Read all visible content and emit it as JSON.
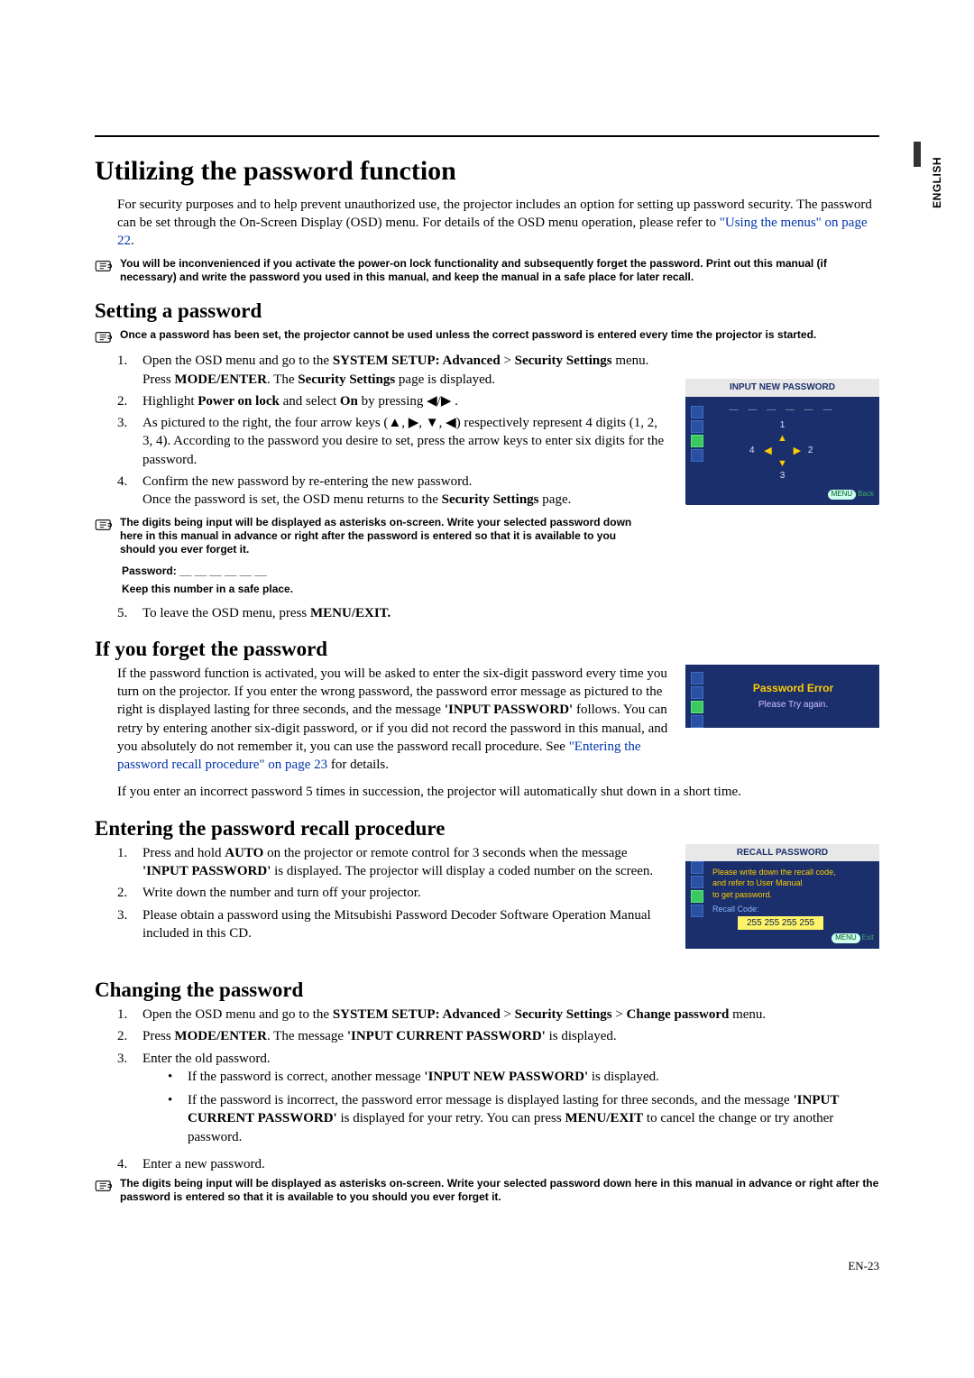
{
  "lang_tab": "ENGLISH",
  "h1": "Utilizing the password function",
  "intro_pre": "For security purposes and to help prevent unauthorized use, the projector includes an option for setting up password security. The password can be set through the On-Screen Display (OSD) menu. For details of the OSD menu operation, please refer to ",
  "intro_link": "\"Using the menus\" on page 22",
  "intro_post": ".",
  "note1": "You will be inconvenienced if you activate the power-on lock functionality and subsequently forget the password. Print out this manual (if necessary) and write the password you used in this manual, and keep the manual in a safe place for later recall.",
  "h2a": "Setting a password",
  "note2": "Once a password has been set, the projector cannot be used unless the correct password is entered every time the projector is started.",
  "stepsA": {
    "s1_a": "Open the OSD menu and go to the ",
    "s1_b": "SYSTEM SETUP: Advanced",
    "s1_c": " > ",
    "s1_d": "Security Settings",
    "s1_e": " menu. Press ",
    "s1_f": "MODE/ENTER",
    "s1_g": ". The ",
    "s1_h": "Security Settings",
    "s1_i": " page is displayed.",
    "s2_a": "Highlight ",
    "s2_b": "Power on lock",
    "s2_c": " and select ",
    "s2_d": "On",
    "s2_e": " by pressing ◀/▶ .",
    "s3": "As pictured to the right, the four arrow keys (▲, ▶, ▼, ◀) respectively represent 4 digits (1, 2, 3, 4). According to the password you desire to set, press the arrow keys to enter six digits for the password.",
    "s4_a": "Confirm the new password by re-entering the new password.",
    "s4_b": "Once the password is set, the OSD menu returns to the ",
    "s4_c": "Security Settings",
    "s4_d": " page."
  },
  "note3": "The digits being input will be displayed as asterisks on-screen. Write your selected password down here in this manual in advance or right after the password is entered so that it is available to you should you ever forget it.",
  "pw_label": "Password: __ __ __ __ __ __",
  "keep": "Keep this number in a safe place.",
  "s5_a": "To leave the OSD menu, press ",
  "s5_b": "MENU/EXIT.",
  "h2b": "If you forget the password",
  "forgot_a": "If the password function is activated, you will be asked to enter the six-digit password every time you turn on the projector. If you enter the wrong password, the password error message as pictured to the right is displayed lasting for three seconds, and the message ",
  "forgot_b": "'INPUT PASSWORD'",
  "forgot_c": " follows. You can retry by entering another six-digit password, or if you did not record the password in this manual, and you absolutely do not remember it, you can use the password recall procedure. See ",
  "forgot_link": "\"Entering the password recall procedure\" on page 23",
  "forgot_d": " for details.",
  "incorrect5": "If you enter an incorrect password 5 times in succession, the projector will automatically shut down in a short time.",
  "h2c": "Entering the password recall procedure",
  "recall": {
    "s1_a": "Press and hold ",
    "s1_b": "AUTO",
    "s1_c": " on the projector or remote control for 3 seconds when the message ",
    "s1_d": "'INPUT PASSWORD'",
    "s1_e": " is displayed. The projector will display a coded number on the screen.",
    "s2": "Write down the number and turn off your projector.",
    "s3": "Please obtain a password using the Mitsubishi Password Decoder Software Operation Manual included in this CD."
  },
  "h2d": "Changing the password",
  "change": {
    "s1_a": "Open the OSD menu and go to the ",
    "s1_b": "SYSTEM SETUP: Advanced",
    "s1_c": " > ",
    "s1_d": "Security Settings",
    "s1_e": " > ",
    "s1_f": "Change password",
    "s1_g": " menu.",
    "s2_a": "Press ",
    "s2_b": "MODE/ENTER",
    "s2_c": ". The message ",
    "s2_d": "'INPUT CURRENT PASSWORD'",
    "s2_e": " is displayed.",
    "s3": "Enter the old password.",
    "b1_a": "If the password is correct, another message ",
    "b1_b": "'INPUT NEW PASSWORD'",
    "b1_c": " is displayed.",
    "b2_a": "If the password is incorrect, the password error message is displayed lasting for three seconds, and the message ",
    "b2_b": "'INPUT CURRENT PASSWORD'",
    "b2_c": " is displayed for your retry. You can press ",
    "b2_d": "MENU/EXIT",
    "b2_e": " to cancel the change or try another password.",
    "s4": "Enter a new password."
  },
  "note4": "The digits being input will be displayed as asterisks on-screen. Write your selected password down here in this manual in advance or right after the password is entered so that it is available to you should you ever forget it.",
  "osd1": {
    "title": "INPUT NEW PASSWORD",
    "n1": "1",
    "n2": "2",
    "n3": "3",
    "n4": "4",
    "menu": "MENU",
    "back": "Back"
  },
  "osd2": {
    "t1": "Password Error",
    "t2": "Please Try again."
  },
  "osd3": {
    "title": "RECALL PASSWORD",
    "line1": "Please write down the recall code,",
    "line2": "and refer to User Manual",
    "line3": "to get password.",
    "label": "Recall Code:",
    "code": "255 255 255 255",
    "menu": "MENU",
    "exit": "Exit"
  },
  "page": "EN-23"
}
